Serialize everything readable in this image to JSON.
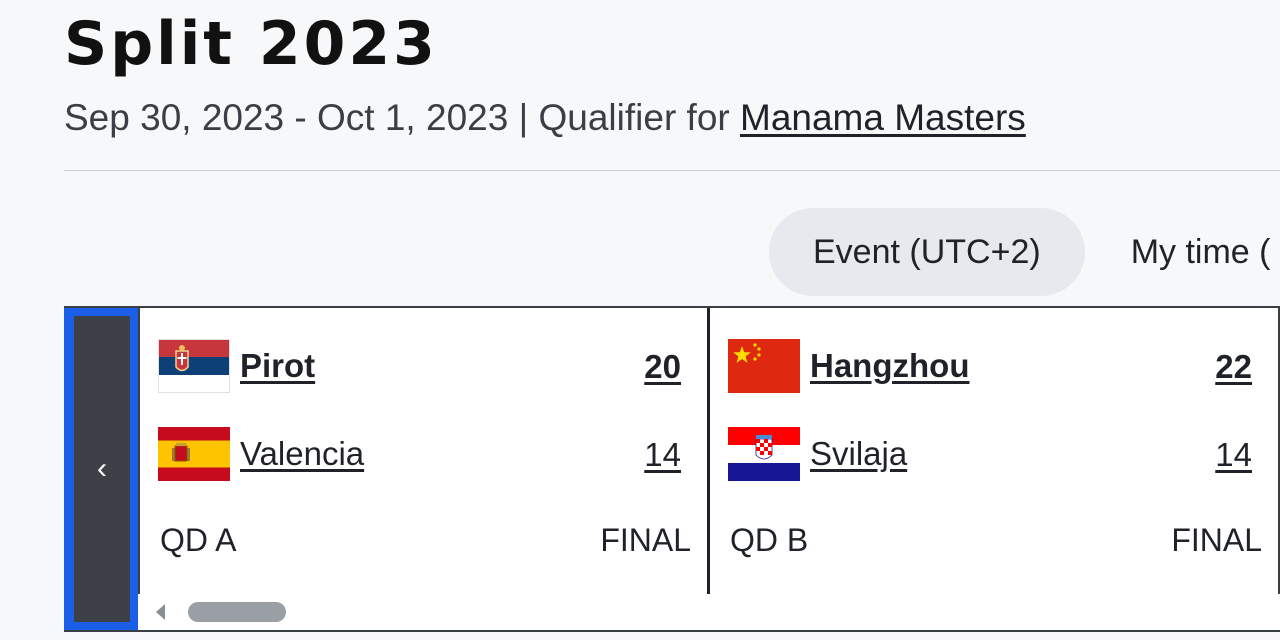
{
  "event": {
    "title": "Split 2023",
    "dates": "Sep 30, 2023 - Oct 1, 2023",
    "separator": " | ",
    "qualifier_prefix": "Qualifier for ",
    "qualifier_link": "Manama Masters"
  },
  "timezone": {
    "active_label": "Event (UTC+2)",
    "other_label": "My time ("
  },
  "scroller": {
    "prev_glyph": "‹"
  },
  "games": [
    {
      "team1": {
        "name": "Pirot",
        "score": "20",
        "flag": "serbia-flag",
        "winner": true
      },
      "team2": {
        "name": "Valencia",
        "score": "14",
        "flag": "spain-flag",
        "winner": false
      },
      "stage": "QD A",
      "status": "FINAL"
    },
    {
      "team1": {
        "name": "Hangzhou",
        "score": "22",
        "flag": "china-flag",
        "winner": true
      },
      "team2": {
        "name": "Svilaja",
        "score": "14",
        "flag": "croatia-flag",
        "winner": false
      },
      "stage": "QD B",
      "status": "FINAL"
    }
  ],
  "colors": {
    "accent": "#1b5ee8",
    "background": "#f7f8fa",
    "toggle_active": "#e6e9ee"
  }
}
